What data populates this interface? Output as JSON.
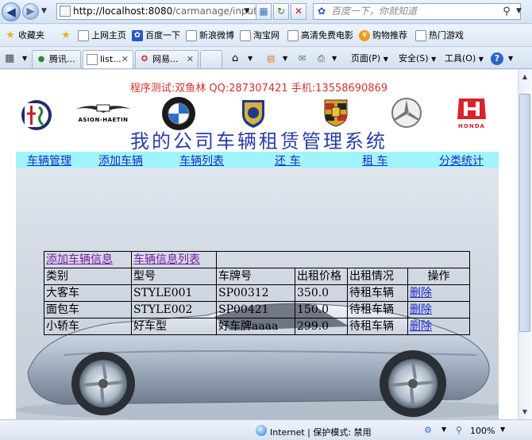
{
  "browser": {
    "url_host": "http://localhost:8080",
    "url_path": "/carmanage/input#",
    "search_placeholder": "百度一下，你就知道"
  },
  "favorites_bar": {
    "items": [
      "收藏夹",
      "上网主页",
      "百度一下",
      "新浪微博",
      "淘宝网",
      "高清免费电影",
      "购物推荐",
      "热门游戏"
    ]
  },
  "tabs": [
    {
      "label": "腾讯...",
      "icon": "qq-icon"
    },
    {
      "label": "list...",
      "icon": "page-icon",
      "active": true
    },
    {
      "label": "网易...",
      "icon": "netease-icon"
    }
  ],
  "command_bar": {
    "page": "页面(P)",
    "safety": "安全(S)",
    "tools": "工具(O)"
  },
  "page": {
    "test_line": "程序测试:双鱼林  QQ:287307421  手机:13558690869",
    "system_title": "我的公司车辆租赁管理系统",
    "brand_logos": [
      "alfa-romeo-logo",
      "aston-martin-logo",
      "bmw-logo",
      "proton-logo",
      "porsche-logo",
      "mercedes-logo",
      "honda-logo"
    ],
    "aston_text": "ASION-HAETIN",
    "honda_text": "HONDA",
    "menu": [
      "车辆管理",
      "添加车辆",
      "车辆列表",
      "还 车",
      "租 车",
      "分类统计"
    ]
  },
  "table": {
    "tabs": [
      "添加车辆信息",
      "车辆信息列表"
    ],
    "headers": [
      "类别",
      "型号",
      "车牌号",
      "出租价格",
      "出租情况",
      "操作"
    ],
    "rows": [
      [
        "大客车",
        "STYLE001",
        "SP00312",
        "350.0",
        "待租车辆",
        "删除"
      ],
      [
        "面包车",
        "STYLE002",
        "SP00421",
        "150.0",
        "待租车辆",
        "删除"
      ],
      [
        "小轿车",
        "好车型",
        "好车牌aaaa",
        "299.0",
        "待租车辆",
        "删除"
      ]
    ]
  },
  "status_bar": {
    "zone": "Internet | 保护模式: 禁用",
    "zoom": "100%"
  },
  "colors": {
    "test_line": "#d2322d",
    "title": "#2a3da8",
    "menu_bg": "#9ff5fb",
    "link": "#1d29c8",
    "visited_link": "#7d1aa8"
  }
}
